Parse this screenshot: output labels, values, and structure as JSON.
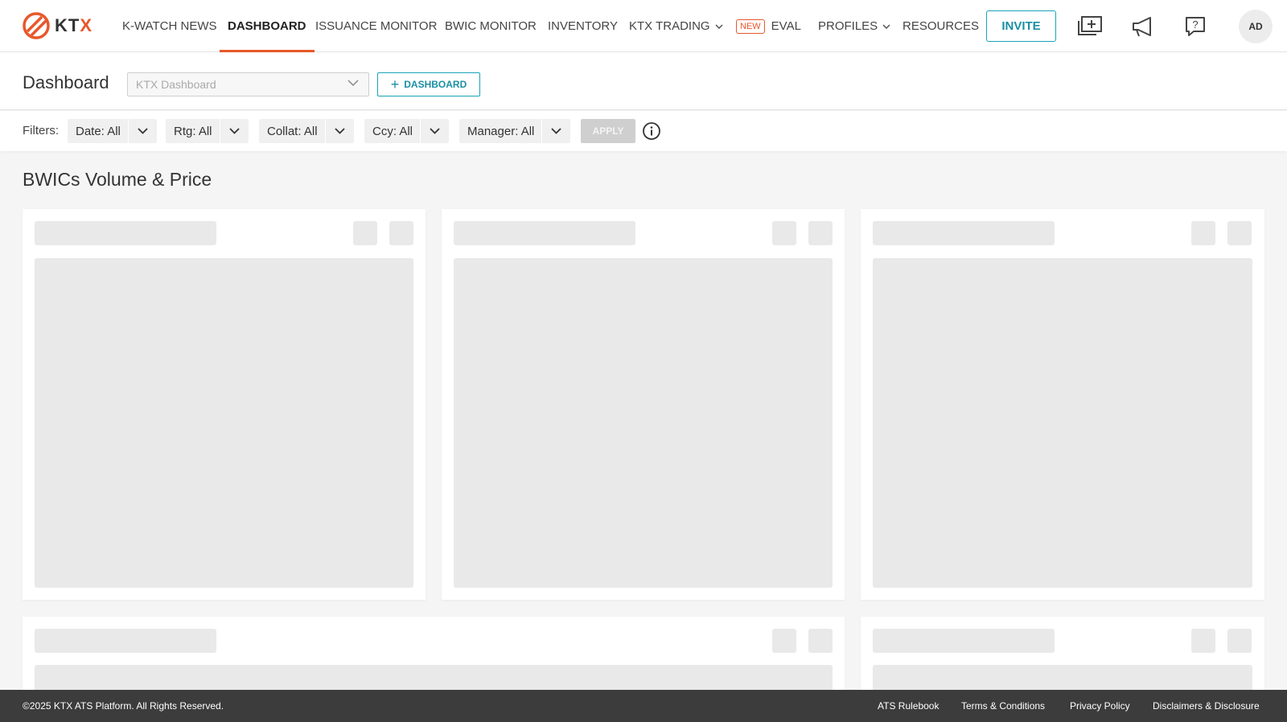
{
  "brand": {
    "logo_text_main": "KT",
    "logo_text_x": "X",
    "accent": "#e8572a",
    "teal": "#1aa3b8"
  },
  "nav": {
    "items": [
      {
        "label": "K-WATCH NEWS"
      },
      {
        "label": "DASHBOARD",
        "active": true
      },
      {
        "label": "ISSUANCE MONITOR"
      },
      {
        "label": "BWIC MONITOR"
      },
      {
        "label": "INVENTORY"
      },
      {
        "label": "KTX TRADING",
        "has_dropdown": true
      },
      {
        "label": "EVAL",
        "badge": "NEW"
      },
      {
        "label": "PROFILES",
        "has_dropdown": true
      },
      {
        "label": "RESOURCES"
      }
    ],
    "invite_label": "INVITE",
    "icons": [
      "add-dashboard-icon",
      "announcement-icon",
      "help-icon"
    ],
    "avatar_initials": "AD"
  },
  "dashboard": {
    "title": "Dashboard",
    "select_placeholder": "KTX Dashboard",
    "add_button_label": "DASHBOARD"
  },
  "filters": {
    "label": "Filters:",
    "items": [
      {
        "label": "Date: All"
      },
      {
        "label": "Rtg: All"
      },
      {
        "label": "Collat: All"
      },
      {
        "label": "Ccy: All"
      },
      {
        "label": "Manager: All"
      }
    ],
    "apply_label": "APPLY"
  },
  "section": {
    "title": "BWICs Volume & Price"
  },
  "footer": {
    "copyright": "©2025 KTX ATS Platform. All Rights Reserved.",
    "links": [
      {
        "label": "ATS Rulebook"
      },
      {
        "label": "Terms & Conditions"
      },
      {
        "label": "Privacy Policy"
      },
      {
        "label": "Disclaimers & Disclosure"
      }
    ]
  }
}
